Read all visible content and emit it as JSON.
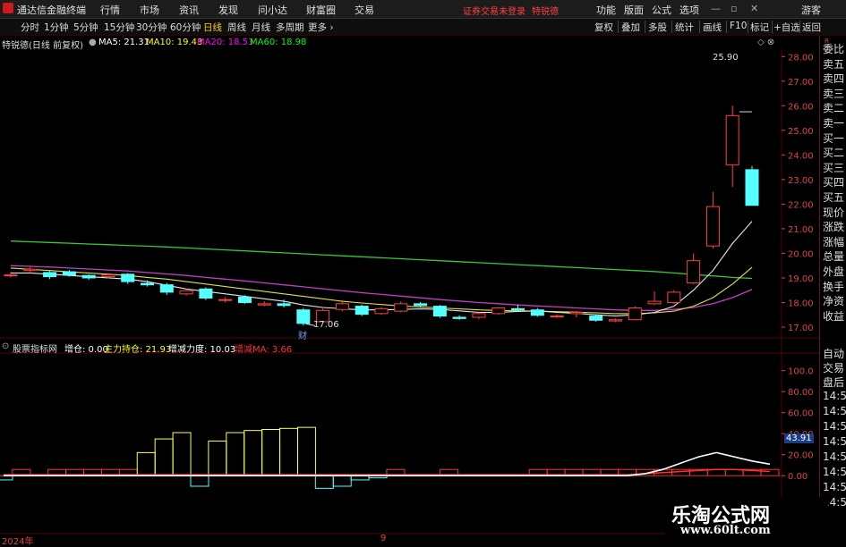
{
  "menubar": {
    "app_title": "通达信金融终端",
    "items": [
      "行情",
      "市场",
      "资讯",
      "发现",
      "问小达",
      "财富圈",
      "交易"
    ],
    "notice": "证券交易未登录",
    "notice2": "特锐德",
    "right_items": [
      "功能",
      "版面",
      "公式",
      "选项"
    ],
    "guest": "游客"
  },
  "toolbar": {
    "periods": [
      "分时",
      "1分钟",
      "5分钟",
      "15分钟",
      "30分钟",
      "60分钟",
      "日线",
      "周线",
      "月线",
      "多周期",
      "更多 ›"
    ],
    "active_period": "日线",
    "right_buttons": [
      "复权",
      "叠加",
      "多股",
      "统计",
      "画线",
      "F10",
      "标记",
      "+自选",
      "返回"
    ]
  },
  "stock": {
    "name_label": "特锐德(日线 前复权)",
    "ma5": "MA5: 21.31",
    "ma10": "MA10: 19.43",
    "ma20": "MA20: 18.53",
    "ma60": "MA60: 18.98",
    "high_label": "25.90",
    "low_label": "17.06",
    "fin_mark": "财"
  },
  "indicator": {
    "name": "股票指标网",
    "zc": "增仓: 0.00",
    "zlcc": "主力持仓: 21.93",
    "zjld": "增减力度: 10.03",
    "zjma": "增减MA: 3.66",
    "current_value": "43.91"
  },
  "axis": {
    "price_ticks": [
      "28.00",
      "27.00",
      "26.00",
      "25.00",
      "24.00",
      "23.00",
      "22.00",
      "21.00",
      "20.00",
      "19.00",
      "18.00",
      "17.00"
    ],
    "ind_ticks": [
      "100.0",
      "80.00",
      "60.00",
      "40.00",
      "20.00",
      "0.00"
    ],
    "x_labels": [
      "2024年",
      "9"
    ]
  },
  "right_panel": {
    "top": [
      "委比",
      "卖五",
      "卖四",
      "卖三",
      "卖二",
      "卖一",
      "买一",
      "买二",
      "买三",
      "买四",
      "买五",
      "现价",
      "涨跌",
      "涨幅",
      "总量",
      "外盘",
      "换手",
      "净资",
      "收益"
    ],
    "bottom": [
      "自动",
      "交易",
      "盘后"
    ],
    "times": [
      "14:56",
      "14:56",
      "14:56",
      "14:56",
      "14:56",
      "14:56",
      "14:56",
      "14:56"
    ]
  },
  "watermark": {
    "line1": "乐淘公式网",
    "line2": "www.60lt.com"
  },
  "colors": {
    "up": "#ff3232",
    "down": "#54ffff",
    "ma5": "#ffffff",
    "ma10": "#ffff00",
    "ma20": "#ff00ff",
    "ma60": "#00ff00",
    "grid_red": "#5a0000"
  },
  "chart_data": {
    "type": "candlestick",
    "price_range": [
      16.6,
      28.3
    ],
    "ohlc": [
      [
        19.1,
        19.25,
        19.02,
        19.12
      ],
      [
        19.3,
        19.45,
        19.2,
        19.35
      ],
      [
        19.22,
        19.3,
        18.95,
        19.05
      ],
      [
        19.25,
        19.32,
        19.05,
        19.12
      ],
      [
        19.1,
        19.15,
        18.92,
        19.0
      ],
      [
        19.05,
        19.18,
        18.98,
        19.12
      ],
      [
        19.15,
        19.2,
        18.75,
        18.85
      ],
      [
        18.78,
        18.9,
        18.65,
        18.72
      ],
      [
        18.72,
        18.8,
        18.3,
        18.42
      ],
      [
        18.35,
        18.55,
        18.28,
        18.48
      ],
      [
        18.55,
        18.62,
        18.1,
        18.18
      ],
      [
        18.1,
        18.22,
        18.0,
        18.12
      ],
      [
        18.22,
        18.3,
        17.95,
        18.0
      ],
      [
        17.9,
        18.05,
        17.85,
        17.95
      ],
      [
        17.95,
        18.12,
        17.8,
        17.88
      ],
      [
        17.7,
        17.78,
        17.06,
        17.15
      ],
      [
        17.22,
        17.75,
        17.18,
        17.68
      ],
      [
        17.72,
        18.1,
        17.65,
        17.95
      ],
      [
        17.85,
        17.92,
        17.45,
        17.52
      ],
      [
        17.55,
        17.82,
        17.5,
        17.75
      ],
      [
        17.65,
        18.05,
        17.6,
        17.95
      ],
      [
        17.95,
        18.02,
        17.82,
        17.88
      ],
      [
        17.85,
        17.9,
        17.38,
        17.45
      ],
      [
        17.4,
        17.48,
        17.3,
        17.35
      ],
      [
        17.4,
        17.6,
        17.32,
        17.55
      ],
      [
        17.55,
        17.82,
        17.5,
        17.78
      ],
      [
        17.75,
        17.92,
        17.65,
        17.7
      ],
      [
        17.7,
        17.78,
        17.42,
        17.48
      ],
      [
        17.45,
        17.52,
        17.38,
        17.45
      ],
      [
        17.55,
        17.65,
        17.4,
        17.6
      ],
      [
        17.45,
        17.52,
        17.22,
        17.28
      ],
      [
        17.25,
        17.35,
        17.2,
        17.3
      ],
      [
        17.3,
        17.85,
        17.28,
        17.78
      ],
      [
        17.95,
        18.45,
        17.9,
        18.05
      ],
      [
        18.0,
        18.5,
        17.95,
        18.42
      ],
      [
        18.8,
        20.0,
        18.75,
        19.7
      ],
      [
        20.3,
        22.5,
        20.2,
        21.9
      ],
      [
        23.6,
        26.0,
        22.7,
        25.6
      ],
      [
        23.4,
        23.55,
        21.95,
        21.95
      ]
    ],
    "ma5": [
      19.2,
      19.2,
      19.15,
      19.1,
      19.05,
      19.0,
      18.95,
      18.85,
      18.7,
      18.55,
      18.45,
      18.35,
      18.25,
      18.15,
      18.05,
      17.9,
      17.8,
      17.75,
      17.7,
      17.7,
      17.72,
      17.74,
      17.72,
      17.66,
      17.6,
      17.6,
      17.64,
      17.66,
      17.6,
      17.56,
      17.5,
      17.45,
      17.5,
      17.6,
      17.85,
      18.5,
      19.3,
      20.4,
      21.3
    ],
    "ma10": [
      19.4,
      19.35,
      19.3,
      19.25,
      19.2,
      19.15,
      19.1,
      19.02,
      18.95,
      18.85,
      18.75,
      18.65,
      18.55,
      18.45,
      18.35,
      18.25,
      18.15,
      18.05,
      17.98,
      17.92,
      17.86,
      17.82,
      17.78,
      17.74,
      17.7,
      17.68,
      17.66,
      17.65,
      17.63,
      17.61,
      17.58,
      17.55,
      17.55,
      17.58,
      17.65,
      17.85,
      18.2,
      18.75,
      19.43
    ],
    "ma20": [
      19.5,
      19.47,
      19.44,
      19.4,
      19.36,
      19.32,
      19.28,
      19.22,
      19.16,
      19.1,
      19.02,
      18.95,
      18.88,
      18.8,
      18.72,
      18.64,
      18.56,
      18.48,
      18.4,
      18.33,
      18.26,
      18.19,
      18.12,
      18.06,
      18.0,
      17.95,
      17.9,
      17.86,
      17.82,
      17.78,
      17.74,
      17.7,
      17.68,
      17.68,
      17.72,
      17.8,
      17.95,
      18.2,
      18.53
    ],
    "ma60": [
      20.5,
      20.47,
      20.44,
      20.41,
      20.38,
      20.35,
      20.32,
      20.29,
      20.26,
      20.22,
      20.18,
      20.14,
      20.1,
      20.06,
      20.02,
      19.98,
      19.94,
      19.9,
      19.86,
      19.82,
      19.78,
      19.74,
      19.7,
      19.66,
      19.62,
      19.58,
      19.54,
      19.5,
      19.46,
      19.42,
      19.38,
      19.34,
      19.3,
      19.26,
      19.2,
      19.14,
      19.08,
      19.02,
      18.98
    ],
    "indicator_range": [
      -10,
      115
    ],
    "bars": [
      0,
      6,
      0,
      6,
      6,
      6,
      6,
      6,
      22,
      35,
      41,
      0,
      33,
      41,
      43,
      44,
      45,
      46,
      0,
      0,
      0,
      0,
      6,
      0,
      0,
      6,
      0,
      0,
      0,
      0,
      6,
      6,
      6,
      6,
      6,
      6,
      6,
      6,
      6,
      6,
      6,
      6,
      6,
      6
    ],
    "bar_colors": [
      "#5ff",
      "#f33",
      "#f33",
      "#f33",
      "#f33",
      "#f33",
      "#f33",
      "#f33",
      "#ff5",
      "#ff5",
      "#ff5",
      "#5ff",
      "#ff5",
      "#ff5",
      "#ff5",
      "#ff5",
      "#ff5",
      "#ff5",
      "#5ff",
      "#5ff",
      "#5ff",
      "#5ff",
      "#f33",
      "#f33",
      "#f33",
      "#f33",
      "#f33",
      "#f33",
      "#f33",
      "#f33",
      "#f33",
      "#f33",
      "#f33",
      "#f33",
      "#f33",
      "#f33",
      "#f33",
      "#f33",
      "#f33",
      "#f33",
      "#f33",
      "#f33",
      "#f33",
      "#f33"
    ],
    "neg_bars": [
      -4,
      0,
      0,
      0,
      0,
      0,
      0,
      0,
      0,
      0,
      0,
      -10,
      0,
      0,
      0,
      0,
      0,
      0,
      -12,
      -10,
      -4,
      -2,
      0,
      0,
      0,
      0,
      0,
      0,
      0,
      0,
      0,
      0,
      0,
      0,
      0,
      0,
      0,
      0,
      0,
      0,
      0,
      0,
      0,
      0
    ],
    "ind_line_white": [
      0,
      0,
      0,
      0,
      0,
      0,
      0,
      0,
      0,
      0,
      0,
      0,
      0,
      0,
      0,
      0,
      0,
      0,
      0,
      0,
      0,
      0,
      0,
      0,
      0,
      0,
      0,
      0,
      0,
      0,
      0,
      0,
      0,
      0,
      0,
      0,
      2,
      6,
      12,
      18,
      22,
      18,
      14,
      11
    ],
    "ind_line_red": [
      1,
      1,
      1,
      1,
      1,
      1,
      1,
      1,
      1,
      1,
      1,
      1,
      1,
      1,
      1,
      1,
      1,
      1,
      1,
      1,
      1,
      1,
      1,
      1,
      1,
      1,
      1,
      1,
      1,
      1,
      1,
      1,
      1,
      1,
      1,
      1,
      2,
      3,
      4,
      5,
      6,
      6,
      5,
      4
    ]
  }
}
